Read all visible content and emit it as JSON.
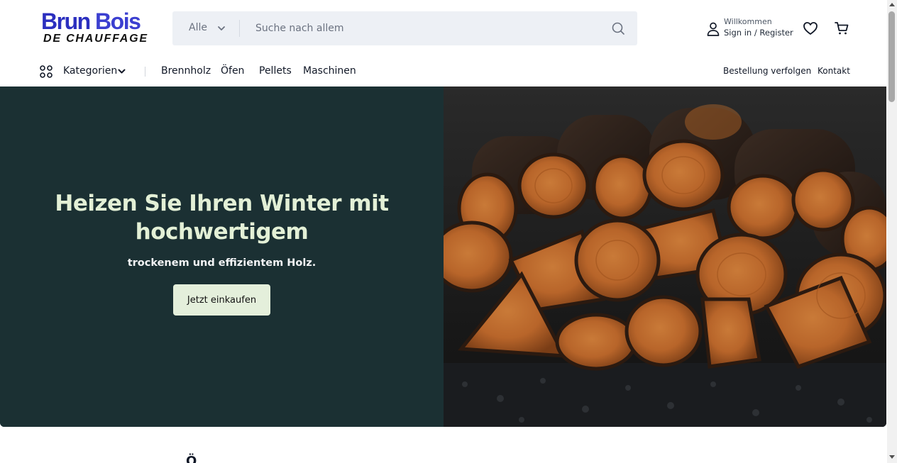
{
  "brand": {
    "name_part1": "Brun ",
    "name_part2": "Bois",
    "subtitle": "DE CHAUFFAGE"
  },
  "search": {
    "category": "Alle",
    "placeholder": "Suche nach allem"
  },
  "account": {
    "welcome": "Willkommen",
    "signin": "Sign in / Register"
  },
  "nav": {
    "categories_label": "Kategorien",
    "links": [
      "Brennholz",
      "Öfen",
      "Pellets",
      "Maschinen"
    ],
    "right_links": [
      "Bestellung verfolgen",
      "Kontakt"
    ]
  },
  "hero": {
    "title": "Heizen Sie Ihren Winter mit hochwertigem",
    "subtitle": "trockenem und effizientem Holz.",
    "cta": "Jetzt einkaufen"
  },
  "next_section_peek": "Ö",
  "colors": {
    "brand_blue": "#3b3fd0",
    "hero_bg": "#1b3033",
    "hero_title": "#e3f0d6",
    "cta_bg": "#e4efdb",
    "search_bg": "#edf0f5"
  },
  "icons": [
    "chevron-down-icon",
    "search-icon",
    "user-icon",
    "heart-icon",
    "cart-icon",
    "grid-icon"
  ]
}
